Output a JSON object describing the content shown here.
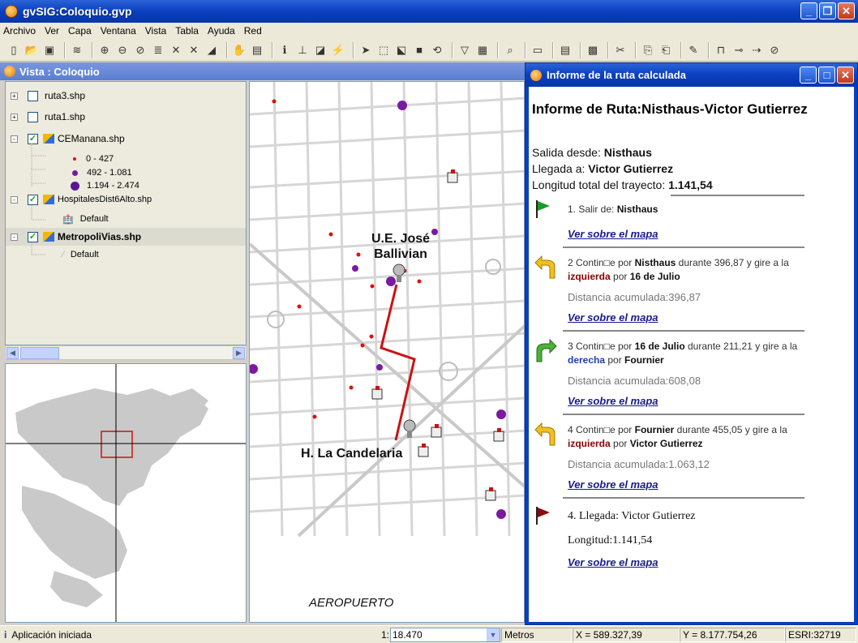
{
  "window": {
    "title": "gvSIG:Coloquio.gvp"
  },
  "menu": [
    "Archivo",
    "Ver",
    "Capa",
    "Ventana",
    "Vista",
    "Tabla",
    "Ayuda",
    "Red"
  ],
  "vista": {
    "title": "Vista : Coloquio",
    "layers": [
      {
        "name": "ruta3.shp",
        "checked": false,
        "expander": "+"
      },
      {
        "name": "ruta1.shp",
        "checked": false,
        "expander": "+"
      },
      {
        "name": "CEManana.shp",
        "checked": true,
        "expander": "-"
      },
      {
        "name": "HospitalesDist6Alto.shp",
        "checked": true,
        "expander": "-"
      },
      {
        "name": "MetropoliVias.shp",
        "checked": true,
        "expander": "-"
      }
    ],
    "legend_cemanana": [
      "0 - 427",
      "492 - 1.081",
      "1.194 - 2.474"
    ],
    "legend_hospitales": "Default",
    "legend_vias": "Default"
  },
  "map": {
    "labels": {
      "school": "U.E. José\nBallivian",
      "hospital": "H. La Candelaria",
      "airport": "AEROPUERTO"
    }
  },
  "report": {
    "window_title": "Informe de la ruta calculada",
    "heading": "Informe de Ruta:Nisthaus-Victor Gutierrez",
    "salida_label": "Salida desde: ",
    "salida_value": "Nisthaus",
    "llegada_label": "Llegada a: ",
    "llegada_value": "Victor Gutierrez",
    "longitud_label": "Longitud total del trayecto: ",
    "longitud_value": "1.141,54",
    "step1_label": "1. Salir de: ",
    "step1_value": "Nisthaus",
    "link": "Ver sobre el mapa",
    "step2": {
      "n": "2 Contin□e por ",
      "street": "Nisthaus",
      "mid": " durante 396,87 y gire a la",
      "dir": "izquierda",
      "por": " por ",
      "to": "16 de Julio",
      "dist": "Distancia acumulada:396,87"
    },
    "step3": {
      "n": "3 Contin□e por ",
      "street": "16 de Julio",
      "mid": " durante 211,21 y gire a la",
      "dir": "derecha",
      "por": " por ",
      "to": "Fournier",
      "dist": "Distancia acumulada:608,08"
    },
    "step4": {
      "n": "4 Contin□e por ",
      "street": "Fournier",
      "mid": " durante 455,05 y gire a la",
      "dir": "izquierda",
      "por": " por ",
      "to": "Victor Gutierrez",
      "dist": "Distancia acumulada:1.063,12"
    },
    "arrival": "4. Llegada: Victor Gutierrez",
    "arrival_length": "Longitud:1.141,54"
  },
  "status": {
    "message": "Aplicación iniciada",
    "scale_prefix": "1:",
    "scale_value": "18.470",
    "units": "Metros",
    "x": "X = 589.327,39",
    "y": "Y = 8.177.754,26",
    "crs": "ESRI:32719"
  },
  "colors": {
    "route": "#cc1111",
    "point_small": "#dd1111",
    "point_large": "#7a1aa0",
    "title_blue": "#0a3fbf"
  }
}
